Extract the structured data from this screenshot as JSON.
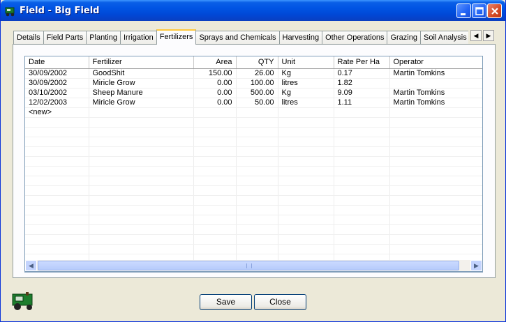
{
  "window": {
    "title": "Field - Big Field"
  },
  "tabs": [
    {
      "label": "Details",
      "active": false
    },
    {
      "label": "Field Parts",
      "active": false
    },
    {
      "label": "Planting",
      "active": false
    },
    {
      "label": "Irrigation",
      "active": false
    },
    {
      "label": "Fertilizers",
      "active": true
    },
    {
      "label": "Sprays and Chemicals",
      "active": false
    },
    {
      "label": "Harvesting",
      "active": false
    },
    {
      "label": "Other Operations",
      "active": false
    },
    {
      "label": "Grazing",
      "active": false
    },
    {
      "label": "Soil Analysis",
      "active": false
    }
  ],
  "tab_scroll": {
    "left": "◀",
    "right": "▶"
  },
  "grid": {
    "columns": [
      "Date",
      "Fertilizer",
      "Area",
      "QTY",
      "Unit",
      "Rate Per Ha",
      "Operator"
    ],
    "rows": [
      {
        "date": "30/09/2002",
        "fertilizer": "GoodShit",
        "area": "150.00",
        "qty": "26.00",
        "unit": "Kg",
        "rate": "0.17",
        "operator": "Martin Tomkins"
      },
      {
        "date": "30/09/2002",
        "fertilizer": "Miricle Grow",
        "area": "0.00",
        "qty": "100.00",
        "unit": "litres",
        "rate": "1.82",
        "operator": ""
      },
      {
        "date": "03/10/2002",
        "fertilizer": "Sheep Manure",
        "area": "0.00",
        "qty": "500.00",
        "unit": "Kg",
        "rate": "9.09",
        "operator": "Martin Tomkins"
      },
      {
        "date": "12/02/2003",
        "fertilizer": "Miricle Grow",
        "area": "0.00",
        "qty": "50.00",
        "unit": "litres",
        "rate": "1.11",
        "operator": "Martin Tomkins"
      }
    ],
    "new_row_label": "<new>",
    "empty_rows": 15
  },
  "buttons": {
    "save": "Save",
    "close": "Close"
  },
  "icons": {
    "title": "tractor-icon",
    "footer": "tractor-icon"
  }
}
